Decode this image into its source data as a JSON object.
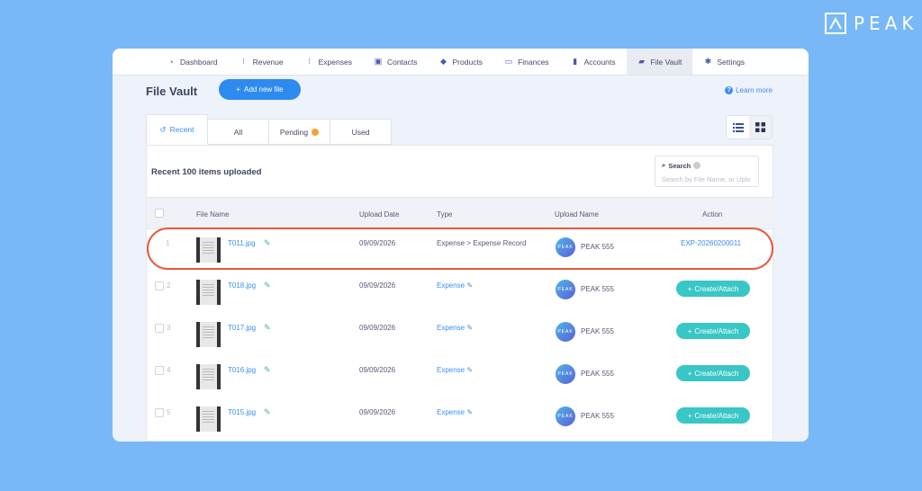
{
  "brand": {
    "name": "PEAK"
  },
  "nav": {
    "items": [
      {
        "label": "Dashboard",
        "icon": "dashboard-icon",
        "active": false
      },
      {
        "label": "Revenue",
        "icon": "revenue-icon",
        "active": false
      },
      {
        "label": "Expenses",
        "icon": "expenses-icon",
        "active": false
      },
      {
        "label": "Contacts",
        "icon": "contacts-icon",
        "active": false
      },
      {
        "label": "Products",
        "icon": "products-icon",
        "active": false
      },
      {
        "label": "Finances",
        "icon": "finances-icon",
        "active": false
      },
      {
        "label": "Accounts",
        "icon": "accounts-icon",
        "active": false
      },
      {
        "label": "File Vault",
        "icon": "folder-icon",
        "active": true
      },
      {
        "label": "Settings",
        "icon": "gear-icon",
        "active": false
      }
    ]
  },
  "header": {
    "title": "File Vault",
    "add_button": "Add new file",
    "learn_more": "Learn more"
  },
  "tabs": [
    {
      "label": "Recent",
      "active": true
    },
    {
      "label": "All",
      "active": false
    },
    {
      "label": "Pending",
      "active": false
    },
    {
      "label": "Used",
      "active": false
    }
  ],
  "panel": {
    "title": "Recent 100 items uploaded",
    "search_label": "Search",
    "search_placeholder": "Search by File Name, or Uplo"
  },
  "table": {
    "columns": [
      "File Name",
      "Upload Date",
      "Type",
      "Upload Name",
      "Action"
    ],
    "rows": [
      {
        "num": "1",
        "file": "T011.jpg",
        "date": "09/09/2026",
        "type": "Expense > Expense Record",
        "uploader": "PEAK 555",
        "action": "EXP-20260200011",
        "action_kind": "link"
      },
      {
        "num": "2",
        "file": "T018.jpg",
        "date": "09/09/2026",
        "type": "Expense",
        "uploader": "PEAK 555",
        "action": "Create/Attach",
        "action_kind": "button"
      },
      {
        "num": "3",
        "file": "T017.jpg",
        "date": "09/09/2026",
        "type": "Expense",
        "uploader": "PEAK 555",
        "action": "Create/Attach",
        "action_kind": "button"
      },
      {
        "num": "4",
        "file": "T016.jpg",
        "date": "09/09/2026",
        "type": "Expense",
        "uploader": "PEAK 555",
        "action": "Create/Attach",
        "action_kind": "button"
      },
      {
        "num": "5",
        "file": "T015.jpg",
        "date": "09/09/2026",
        "type": "Expense",
        "uploader": "PEAK 555",
        "action": "Create/Attach",
        "action_kind": "button"
      }
    ]
  },
  "colors": {
    "background": "#78b8f6",
    "primary": "#2d8bf0",
    "attach": "#39c6c6",
    "highlight": "#e8573a",
    "pending": "#f7a133"
  }
}
